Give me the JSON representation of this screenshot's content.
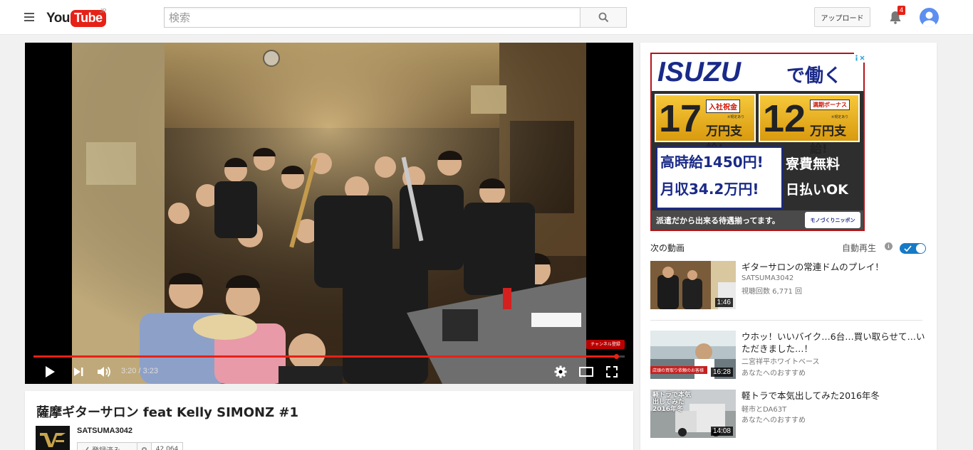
{
  "masthead": {
    "logo_you": "You",
    "logo_tube": "Tube",
    "logo_region": "JP",
    "search_placeholder": "検索",
    "upload_label": "アップロード",
    "notification_count": "4"
  },
  "player": {
    "time_display": "3:20 / 3:23",
    "progress_fraction": 0.985,
    "channel_watermark": "チャンネル登録"
  },
  "video": {
    "title": "薩摩ギターサロン feat Kelly SIMONZ #1",
    "owner": "SATSUMA3042",
    "subscribe_label": "登録済み",
    "subscriber_count": "42,064"
  },
  "ad": {
    "brand": "ISUZU",
    "brand_suffix": "で働く",
    "box1_number": "17",
    "box1_tag": "入社祝金",
    "box1_unit": "万円支給!",
    "box1_note": "※規定あり",
    "box2_number": "12",
    "box2_tag": "満期ボーナス",
    "box2_unit": "万円支給!",
    "box2_note": "※規定あり",
    "wage_line1": "高時給1450円!",
    "wage_line2": "月収34.2万円!",
    "red_line1": "寮費無料",
    "red_line2": "日払いOK",
    "footer_text": "派遣だから出来る待遇揃ってます。",
    "footer_logo": "モノづくりニッポン"
  },
  "sidebar": {
    "up_next_label": "次の動画",
    "autoplay_label": "自動再生",
    "autoplay_on": true,
    "related": [
      {
        "title": "ギターサロンの常連ドムのプレイ！",
        "channel": "SATSUMA3042",
        "meta": "視聴回数 6,771 回",
        "duration": "1:46"
      },
      {
        "title": "ウホッ！いいバイク…6台…買い取らせて…いただきました…！",
        "channel": "二宮祥平ホワイトベース",
        "meta": "あなたへのおすすめ",
        "duration": "16:28",
        "thumb_caption": "店頭の買取り依頼のお客様"
      },
      {
        "title": "軽トラで本気出してみた2016年冬",
        "channel": "軽市とDA63T",
        "meta": "あなたへのおすすめ",
        "duration": "14:08",
        "thumb_caption": "軽トラで本気出してみた 2016年冬"
      }
    ]
  },
  "colors": {
    "brand_red": "#e62117",
    "autoplay_blue": "#167ac6",
    "ad_navy": "#1a2a88"
  }
}
